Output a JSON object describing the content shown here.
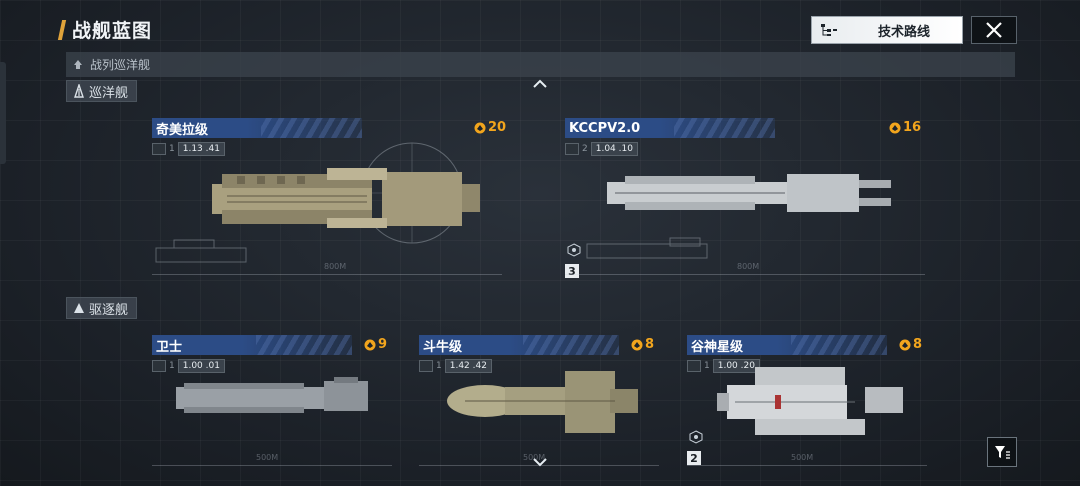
{
  "header": {
    "title": "战舰蓝图",
    "tech_route_label": "技术路线"
  },
  "class_bar": {
    "label": "战列巡洋舰"
  },
  "categories": {
    "cruiser": "巡洋舰",
    "destroyer": "驱逐舰"
  },
  "ships": [
    {
      "name": "奇美拉级",
      "cost": "20",
      "tier": "1",
      "ratio": "1.13 .41",
      "scale": "800M"
    },
    {
      "name": "KCCPV2.0",
      "cost": "16",
      "tier": "2",
      "ratio": "1.04 .10",
      "scale": "800M",
      "count_badge": "3"
    },
    {
      "name": "卫士",
      "cost": "9",
      "tier": "1",
      "ratio": "1.00 .01",
      "scale": "500M"
    },
    {
      "name": "斗牛级",
      "cost": "8",
      "tier": "1",
      "ratio": "1.42 .42",
      "scale": "500M"
    },
    {
      "name": "谷神星级",
      "cost": "8",
      "tier": "1",
      "ratio": "1.00 .20",
      "scale": "500M",
      "count_badge": "2"
    }
  ],
  "colors": {
    "accent": "#e0a33a",
    "cost": "#f2a51d",
    "name_bar": "#2c4c86",
    "hull_tan": "#a9a07f",
    "hull_grey": "#c9cdd0"
  }
}
